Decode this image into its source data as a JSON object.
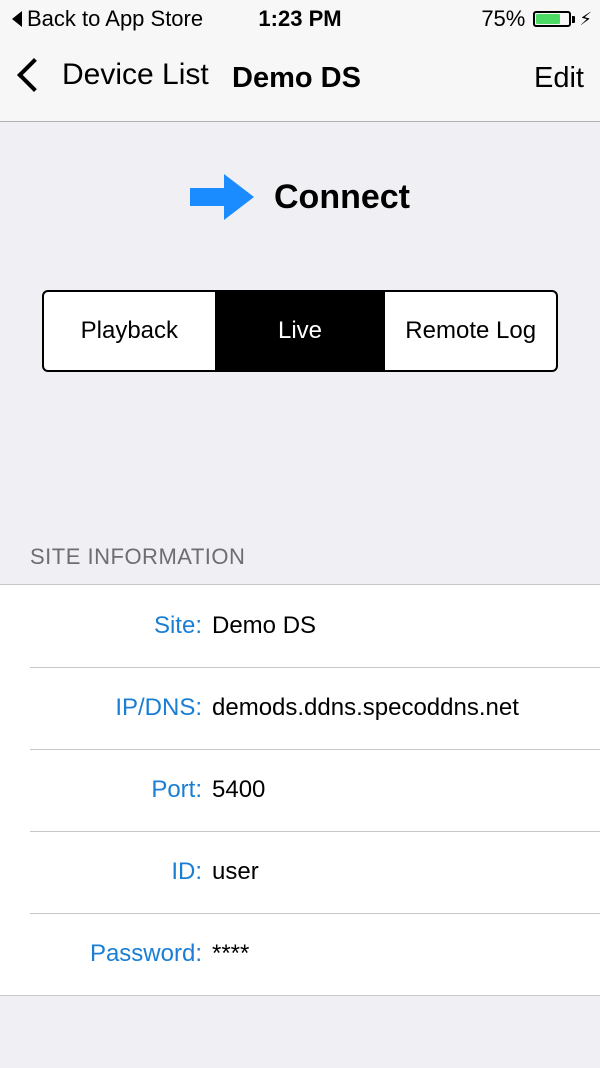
{
  "status_bar": {
    "back_label": "Back to App Store",
    "time": "1:23 PM",
    "battery_percent": "75%",
    "battery_level": 0.75,
    "battery_color": "#4cd964"
  },
  "nav": {
    "back_label": "Device List",
    "title": "Demo DS",
    "edit_label": "Edit"
  },
  "connect": {
    "label": "Connect",
    "arrow_icon": "arrow-right-icon",
    "arrow_color": "#1a8cff"
  },
  "segments": {
    "items": [
      "Playback",
      "Live",
      "Remote Log"
    ],
    "selected": "Live"
  },
  "site_info": {
    "header": "SITE INFORMATION",
    "rows": [
      {
        "label": "Site:",
        "value": "Demo DS"
      },
      {
        "label": "IP/DNS:",
        "value": "demods.ddns.specoddns.net"
      },
      {
        "label": "Port:",
        "value": "5400"
      },
      {
        "label": "ID:",
        "value": "user"
      },
      {
        "label": "Password:",
        "value": "****"
      }
    ],
    "label_color": "#1a7fd4"
  }
}
